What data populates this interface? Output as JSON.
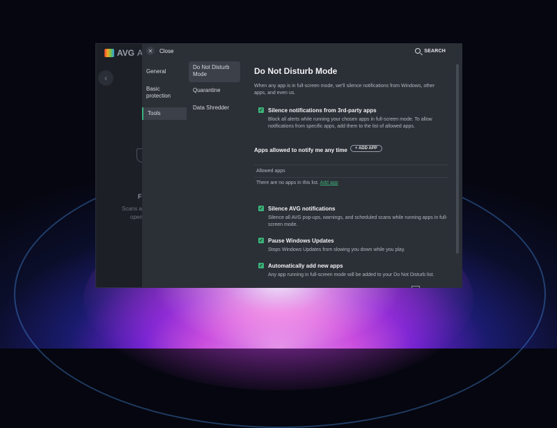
{
  "app": {
    "brand": "AVG",
    "brand_suffix": "Ant",
    "feature_text": "Fi",
    "scan_lines": [
      "Scans ar",
      "openi"
    ]
  },
  "header": {
    "close_label": "Close",
    "search_label": "SEARCH"
  },
  "nav": {
    "items": [
      {
        "label": "General",
        "active": false
      },
      {
        "label": "Basic protection",
        "active": false
      },
      {
        "label": "Tools",
        "active": true
      }
    ]
  },
  "subnav": {
    "items": [
      {
        "label": "Do Not Disturb Mode",
        "active": true
      },
      {
        "label": "Quarantine",
        "active": false
      },
      {
        "label": "Data Shredder",
        "active": false
      }
    ]
  },
  "content": {
    "title": "Do Not Disturb Mode",
    "intro": "When any app is in full-screen mode, we'll silence notifications from Windows, other apps, and even us.",
    "options": [
      {
        "title": "Silence notifications from 3rd-party apps",
        "desc": "Block all alerts while running your chosen apps in full-screen mode. To allow notifications from specific apps, add them to the list of allowed apps.",
        "checked": true
      },
      {
        "title": "Silence AVG notifications",
        "desc": "Silence all AVG pop-ups, warnings, and scheduled scans while running apps in full-screen mode.",
        "checked": true
      },
      {
        "title": "Pause Windows Updates",
        "desc": "Stops Windows Updates from slowing you down while you play.",
        "checked": true
      },
      {
        "title": "Automatically add new apps",
        "desc": "Any app running in full-screen mode will be added to your Do Not Disturb list.",
        "checked": true
      }
    ],
    "allowed_section_label": "Apps allowed to notify me any time",
    "add_app_button": "+ ADD APP",
    "allowed_header": "Allowed apps",
    "no_apps_text": "There are no apps in this list.",
    "add_app_link": "Add app"
  },
  "colors": {
    "accent": "#3bb27a",
    "dialog_bg": "#2b2f36"
  }
}
